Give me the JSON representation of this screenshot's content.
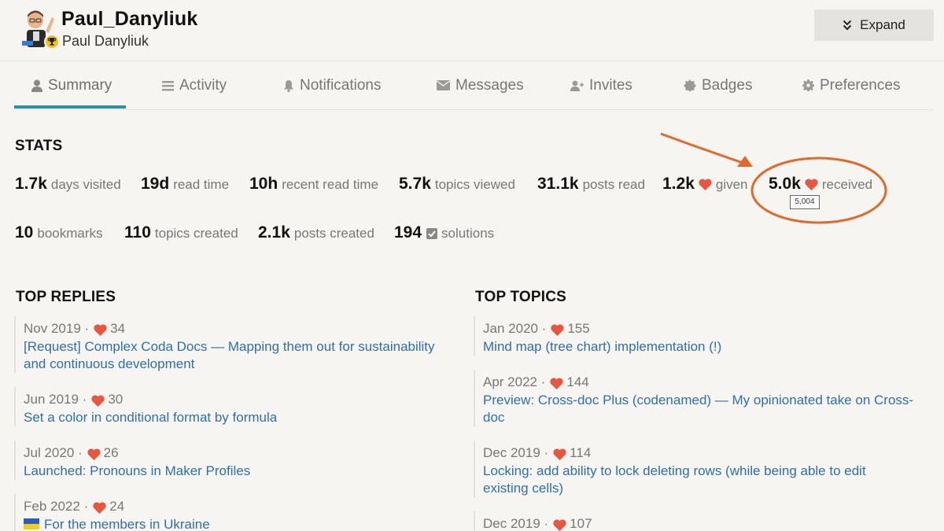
{
  "profile": {
    "username": "Paul_Danyliuk",
    "full_name": "Paul Danyliuk",
    "expand_label": "Expand"
  },
  "tabs": [
    {
      "label": "Summary",
      "icon": "user-icon",
      "active": true
    },
    {
      "label": "Activity",
      "icon": "list-icon"
    },
    {
      "label": "Notifications",
      "icon": "bell-icon"
    },
    {
      "label": "Messages",
      "icon": "envelope-icon"
    },
    {
      "label": "Invites",
      "icon": "user-plus-icon"
    },
    {
      "label": "Badges",
      "icon": "badge-icon"
    },
    {
      "label": "Preferences",
      "icon": "gear-icon"
    }
  ],
  "stats": {
    "title": "STATS",
    "items": [
      {
        "value": "1.7k",
        "label": "days visited"
      },
      {
        "value": "19d",
        "label": "read time"
      },
      {
        "value": "10h",
        "label": "recent read time"
      },
      {
        "value": "5.7k",
        "label": "topics viewed"
      },
      {
        "value": "31.1k",
        "label": "posts read"
      },
      {
        "value": "1.2k",
        "label": "given"
      },
      {
        "value": "5.0k",
        "label": "received"
      },
      {
        "value": "10",
        "label": "bookmarks"
      },
      {
        "value": "110",
        "label": "topics created"
      },
      {
        "value": "2.1k",
        "label": "posts created"
      },
      {
        "value": "194",
        "label": "solutions"
      }
    ],
    "received_tooltip": "5,004"
  },
  "top_replies": {
    "title": "TOP REPLIES",
    "items": [
      {
        "date": "Nov 2019",
        "likes": "34",
        "title": "[Request] Complex Coda Docs — Mapping them out for sustainability and continuous development"
      },
      {
        "date": "Jun 2019",
        "likes": "30",
        "title": "Set a color in conditional format by formula"
      },
      {
        "date": "Jul 2020",
        "likes": "26",
        "title": "Launched: Pronouns in Maker Profiles"
      },
      {
        "date": "Feb 2022",
        "likes": "24",
        "title": "For the members in Ukraine"
      }
    ]
  },
  "top_topics": {
    "title": "TOP TOPICS",
    "items": [
      {
        "date": "Jan 2020",
        "likes": "155",
        "title": "Mind map (tree chart) implementation (!)"
      },
      {
        "date": "Apr 2022",
        "likes": "144",
        "title": "Preview: Cross-doc Plus (codenamed) — My opinionated take on Cross-doc"
      },
      {
        "date": "Dec 2019",
        "likes": "114",
        "title": "Locking: add ability to lock deleting rows (while being able to edit existing cells)"
      },
      {
        "date": "Dec 2019",
        "likes": "107",
        "title": ""
      }
    ]
  },
  "colors": {
    "accent": "#2d8fa7",
    "heart": "#e8563f",
    "link": "#2f6eb0",
    "annotation": "#e06a2c"
  }
}
